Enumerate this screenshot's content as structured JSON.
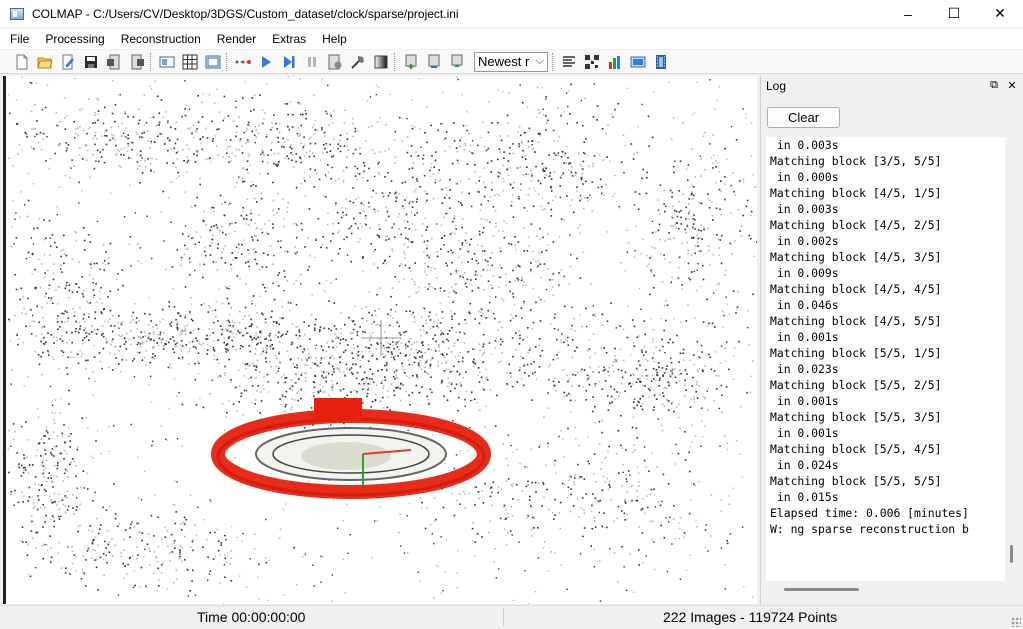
{
  "window": {
    "title": "COLMAP - C:/Users/CV/Desktop/3DGS/Custom_dataset/clock/sparse/project.ini",
    "controls": {
      "minimize": "–",
      "maximize": "☐",
      "close": "✕"
    }
  },
  "menu": [
    "File",
    "Processing",
    "Reconstruction",
    "Render",
    "Extras",
    "Help"
  ],
  "toolbar": {
    "icons": [
      "new-project-icon",
      "open-project-icon",
      "edit-project-icon",
      "save-project-icon",
      "import-model-icon",
      "export-model-icon",
      "feature-extraction-icon",
      "feature-matching-icon",
      "database-management-icon",
      "connect-points-icon",
      "start-reconstruction-icon",
      "step-reconstruction-icon",
      "pause-reconstruction-icon",
      "reconstruction-options-icon",
      "bundle-adjustment-icon",
      "render-options-icon",
      "add-model-icon",
      "remove-model-icon",
      "reset-model-icon",
      "log-icon",
      "match-matrix-icon",
      "statistics-icon",
      "screenshot-icon",
      "grab-movie-icon"
    ],
    "model_select_value": "Newest r"
  },
  "log": {
    "title": "Log",
    "clear_label": "Clear",
    "lines": [
      " in 0.003s",
      "Matching block [3/5, 5/5]",
      " in 0.000s",
      "Matching block [4/5, 1/5]",
      " in 0.003s",
      "Matching block [4/5, 2/5]",
      " in 0.002s",
      "Matching block [4/5, 3/5]",
      " in 0.009s",
      "Matching block [4/5, 4/5]",
      " in 0.046s",
      "Matching block [4/5, 5/5]",
      " in 0.001s",
      "Matching block [5/5, 1/5]",
      " in 0.023s",
      "Matching block [5/5, 2/5]",
      " in 0.001s",
      "Matching block [5/5, 3/5]",
      " in 0.001s",
      "Matching block [5/5, 4/5]",
      " in 0.024s",
      "Matching block [5/5, 5/5]",
      " in 0.015s",
      "Elapsed time: 0.006 [minutes]",
      "W: ng sparse reconstruction b"
    ]
  },
  "status": {
    "time": "Time 00:00:00:00",
    "summary": "222 Images - 119724 Points"
  },
  "colors": {
    "camera_ring": "#e8200e",
    "axis_red": "#e23b2e",
    "axis_green": "#22a822",
    "points_dark": "#333333",
    "points_light": "#b8b8b0"
  }
}
